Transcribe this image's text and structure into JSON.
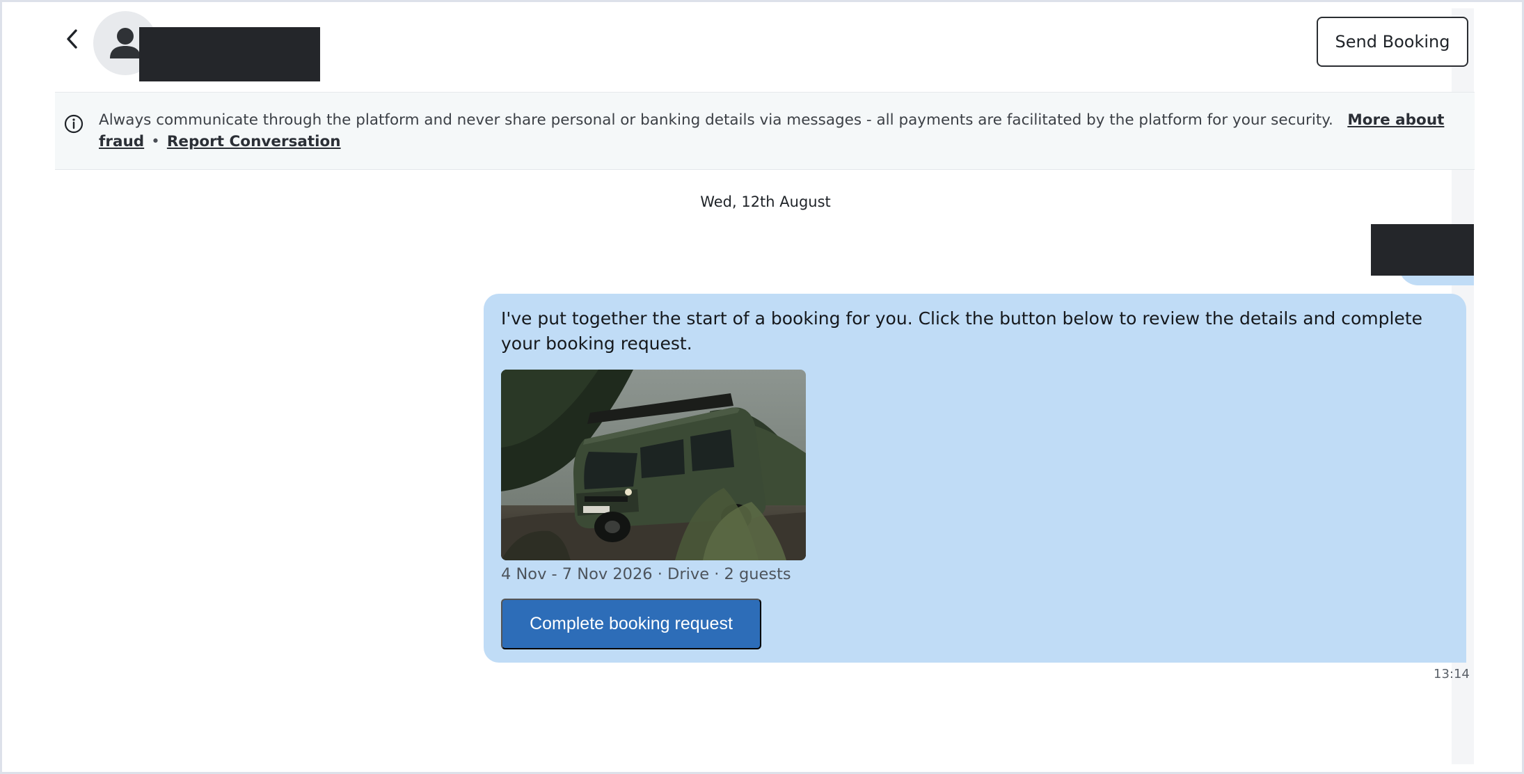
{
  "header": {
    "back_icon": "chevron-left-icon",
    "avatar_icon": "user-icon",
    "send_booking_label": "Send Booking"
  },
  "notice": {
    "icon": "info-icon",
    "text": "Always communicate through the platform and never share personal or banking details via messages - all payments are facilitated by the platform for your security.",
    "more_link": "More about fraud",
    "separator": "•",
    "report_link": "Report Conversation"
  },
  "conversation": {
    "date": "Wed, 12th August",
    "message": {
      "text": "I've put together the start of a booking for you. Click the button below to review the details and complete your booking request.",
      "meta": "4 Nov - 7 Nov 2026 · Drive · 2 guests",
      "cta_label": "Complete booking request",
      "time": "13:14"
    }
  },
  "colors": {
    "bubble": "#c0dcf6",
    "primary_button": "#2d6db8",
    "notice_bg": "#f5f8f9"
  }
}
